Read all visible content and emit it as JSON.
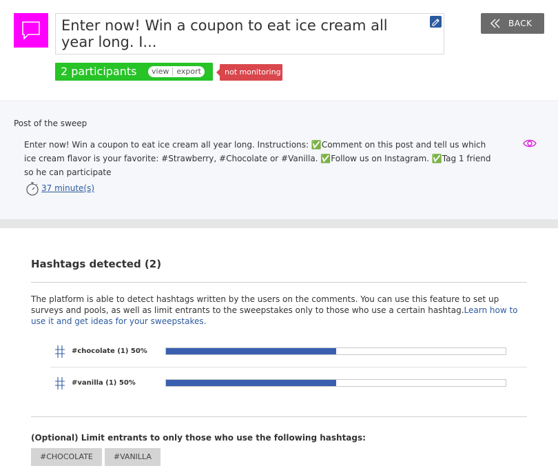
{
  "header": {
    "title": "Enter now! Win a coupon to eat ice cream all year long. I...",
    "back_label": "BACK",
    "participants_label": "2 participants",
    "view_label": "view",
    "export_label": "export",
    "status_badge": "not monitoring"
  },
  "post": {
    "section_label": "Post of the sweep",
    "text": "Enter now! Win a coupon to eat ice cream all year long. Instructions: ✅Comment on this post and tell us which ice cream flavor is your favorite: #Strawberry, #Chocolate or #Vanilla. ✅Follow us on Instagram. ✅Tag 1 friend so he can participate",
    "elapsed": "37 minute(s)"
  },
  "hashtags": {
    "title": "Hashtags detected (2)",
    "description": "The platform is able to detect hashtags written by the users on the comments. You can use this feature to set up surveys and pools, as well as limit entrants to the sweepstakes only to those who use a certain hashtag.",
    "learn_link": "Learn how to use it and get ideas for your sweepstakes.",
    "items": [
      {
        "label": "#chocolate (1) 50%",
        "fraction": 0.5
      },
      {
        "label": "#vanilla (1) 50%",
        "fraction": 0.5
      }
    ],
    "limit_label": "(Optional) Limit entrants to only those who use the following hashtags:",
    "chips": [
      "#CHOCOLATE",
      "#VANILLA"
    ]
  },
  "colors": {
    "brand": "#ff00ff",
    "participants": "#27c327",
    "badge": "#d9474c",
    "bar_fill": "#3a5fb0",
    "link": "#2c5aa0"
  },
  "icons": [
    "chat-bubble-icon",
    "edit-icon",
    "chevron-double-left-icon",
    "eye-icon",
    "stopwatch-icon",
    "hash-icon"
  ]
}
